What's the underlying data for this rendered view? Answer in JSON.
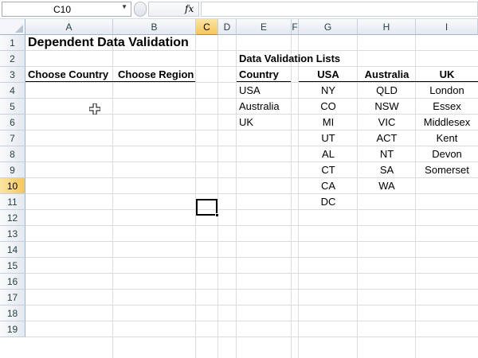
{
  "formula_bar": {
    "name_box": "C10",
    "fx_label": "fx",
    "formula": ""
  },
  "columns": [
    "A",
    "B",
    "C",
    "D",
    "E",
    "F",
    "G",
    "H",
    "I"
  ],
  "rows": [
    "1",
    "2",
    "3",
    "4",
    "5",
    "6",
    "7",
    "8",
    "9",
    "10",
    "11",
    "12",
    "13",
    "14",
    "15",
    "16",
    "17",
    "18",
    "19"
  ],
  "selected": {
    "column": "C",
    "row": "10"
  },
  "sheet": {
    "title": "Dependent Data Validation",
    "lists_title": "Data Validation Lists",
    "choose_country": "Choose Country",
    "choose_region": "Choose Region",
    "country_header": "Country",
    "countries": [
      "USA",
      "Australia",
      "UK"
    ],
    "list_headers": [
      "USA",
      "Australia",
      "UK"
    ],
    "usa": [
      "NY",
      "CO",
      "MI",
      "UT",
      "AL",
      "CT",
      "CA",
      "DC"
    ],
    "australia": [
      "QLD",
      "NSW",
      "VIC",
      "ACT",
      "NT",
      "SA",
      "WA"
    ],
    "uk": [
      "London",
      "Essex",
      "Middlesex",
      "Kent",
      "Devon",
      "Somerset"
    ]
  }
}
